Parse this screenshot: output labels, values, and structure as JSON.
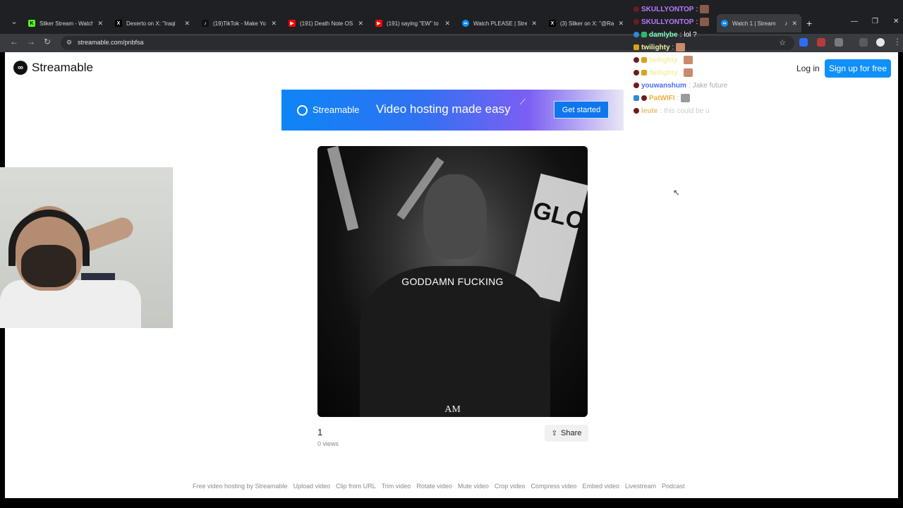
{
  "browser": {
    "tabs": [
      {
        "title": "Sliker Stream - Watch",
        "favicon": "kick-icon",
        "color": "#53fc18",
        "active": false
      },
      {
        "title": "Dexerto on X: \"Iraqi",
        "favicon": "x-icon",
        "color": "#000000",
        "active": false
      },
      {
        "title": "(19)TikTok - Make Yo",
        "favicon": "tiktok-icon",
        "color": "#000000",
        "active": false
      },
      {
        "title": "(191) Death Note OS",
        "favicon": "youtube-icon",
        "color": "#ff0000",
        "active": false
      },
      {
        "title": "(191) saying \"EW\" to",
        "favicon": "youtube-icon",
        "color": "#ff0000",
        "active": false
      },
      {
        "title": "Watch PLEASE | Stre",
        "favicon": "streamable-icon",
        "color": "#0f90fa",
        "active": false
      },
      {
        "title": "(3) Sliker on X: \"@Ra",
        "favicon": "x-icon",
        "color": "#000000",
        "active": false
      },
      {
        "title": "Watch 1 | Stream",
        "favicon": "streamable-icon",
        "color": "#0f90fa",
        "active": true
      }
    ],
    "url": "streamable.com/pnbfsa"
  },
  "header": {
    "brand": "Streamable",
    "login_label": "Log in",
    "signup_label": "Sign up for free"
  },
  "banner": {
    "brand": "Streamable",
    "tagline": "Video hosting made easy",
    "cta": "Get started"
  },
  "video": {
    "subtitle": "GODDAMN FUCKING",
    "watermark": "AM",
    "title": "1",
    "views": "0 views",
    "share_label": "Share"
  },
  "footer": {
    "links": [
      "Free video hosting by Streamable",
      "Upload video",
      "Clip from URL",
      "Trim video",
      "Rotate video",
      "Mute video",
      "Crop video",
      "Compress video",
      "Embed video",
      "Livestream",
      "Podcast"
    ]
  },
  "chat": [
    {
      "name": "SKULLYONTOP",
      "message": "",
      "color": "#b57bff",
      "emote": "#8a5a4a"
    },
    {
      "name": "SKULLYONTOP",
      "message": "",
      "color": "#b57bff",
      "emote": "#8a5a4a"
    },
    {
      "name": "damlybe",
      "message": "lol ?",
      "color": "#7fffbf",
      "emote": ""
    },
    {
      "name": "twilighty",
      "message": "",
      "color": "#f2f2a0",
      "emote": "#c98b6b"
    },
    {
      "name": "twilighty",
      "message": "",
      "color": "#f2f2a0",
      "emote": "#c98b6b"
    },
    {
      "name": "twilighty",
      "message": "",
      "color": "#f2f2a0",
      "emote": "#c98b6b"
    },
    {
      "name": "youwanshum",
      "message": "Jake future",
      "color": "#4b6cff",
      "emote": ""
    },
    {
      "name": "PatWIFI",
      "message": "",
      "color": "#f0b040",
      "emote": "#9a9a9a"
    },
    {
      "name": "leute",
      "message": "this could be u",
      "color": "#e8c070",
      "emote": ""
    }
  ]
}
